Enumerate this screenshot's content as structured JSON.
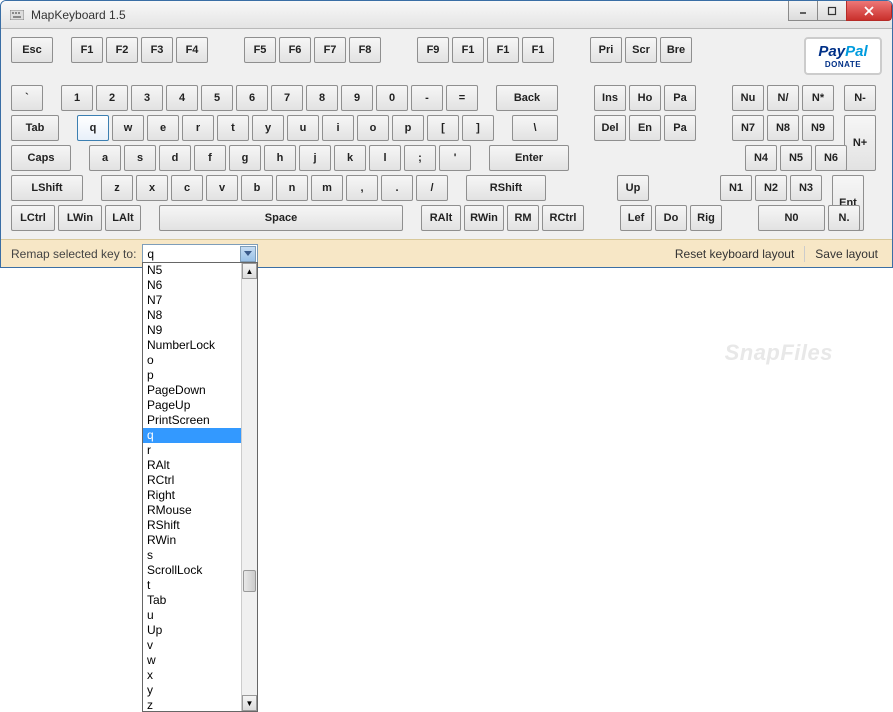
{
  "window": {
    "title": "MapKeyboard 1.5"
  },
  "paypal": {
    "pay": "Pay",
    "pal": "Pal",
    "donate": "DONATE"
  },
  "keys": {
    "row_fn": [
      "Esc",
      "F1",
      "F2",
      "F3",
      "F4",
      "F5",
      "F6",
      "F7",
      "F8",
      "F9",
      "F1",
      "F1",
      "F1",
      "Pri",
      "Scr",
      "Bre"
    ],
    "row_num": [
      "`",
      "1",
      "2",
      "3",
      "4",
      "5",
      "6",
      "7",
      "8",
      "9",
      "0",
      "-",
      "=",
      "Back",
      "Ins",
      "Ho",
      "Pa",
      "Nu",
      "N/",
      "N*",
      "N-"
    ],
    "row_q": [
      "Tab",
      "q",
      "w",
      "e",
      "r",
      "t",
      "y",
      "u",
      "i",
      "o",
      "p",
      "[",
      "]",
      "\\",
      "Del",
      "En",
      "Pa",
      "N7",
      "N8",
      "N9"
    ],
    "row_a": [
      "Caps",
      "a",
      "s",
      "d",
      "f",
      "g",
      "h",
      "j",
      "k",
      "l",
      ";",
      "'",
      "Enter",
      "N4",
      "N5",
      "N6"
    ],
    "nplus": "N+",
    "row_z": [
      "LShift",
      "z",
      "x",
      "c",
      "v",
      "b",
      "n",
      "m",
      ",",
      ".",
      "/",
      "RShift",
      "Up",
      "N1",
      "N2",
      "N3"
    ],
    "row_ctrl": [
      "LCtrl",
      "LWin",
      "LAlt",
      "Space",
      "RAlt",
      "RWin",
      "RM",
      "RCtrl",
      "Lef",
      "Do",
      "Rig",
      "N0",
      "N."
    ],
    "ent": "Ent"
  },
  "remap": {
    "label": "Remap selected key to:",
    "current": "q",
    "reset": "Reset keyboard layout",
    "save": "Save layout"
  },
  "dropdown": {
    "items": [
      "N5",
      "N6",
      "N7",
      "N8",
      "N9",
      "NumberLock",
      "o",
      "p",
      "PageDown",
      "PageUp",
      "PrintScreen",
      "q",
      "r",
      "RAlt",
      "RCtrl",
      "Right",
      "RMouse",
      "RShift",
      "RWin",
      "s",
      "ScrollLock",
      "t",
      "Tab",
      "u",
      "Up",
      "v",
      "w",
      "x",
      "y",
      "z"
    ],
    "selected": "q"
  },
  "watermark": "SnapFiles"
}
